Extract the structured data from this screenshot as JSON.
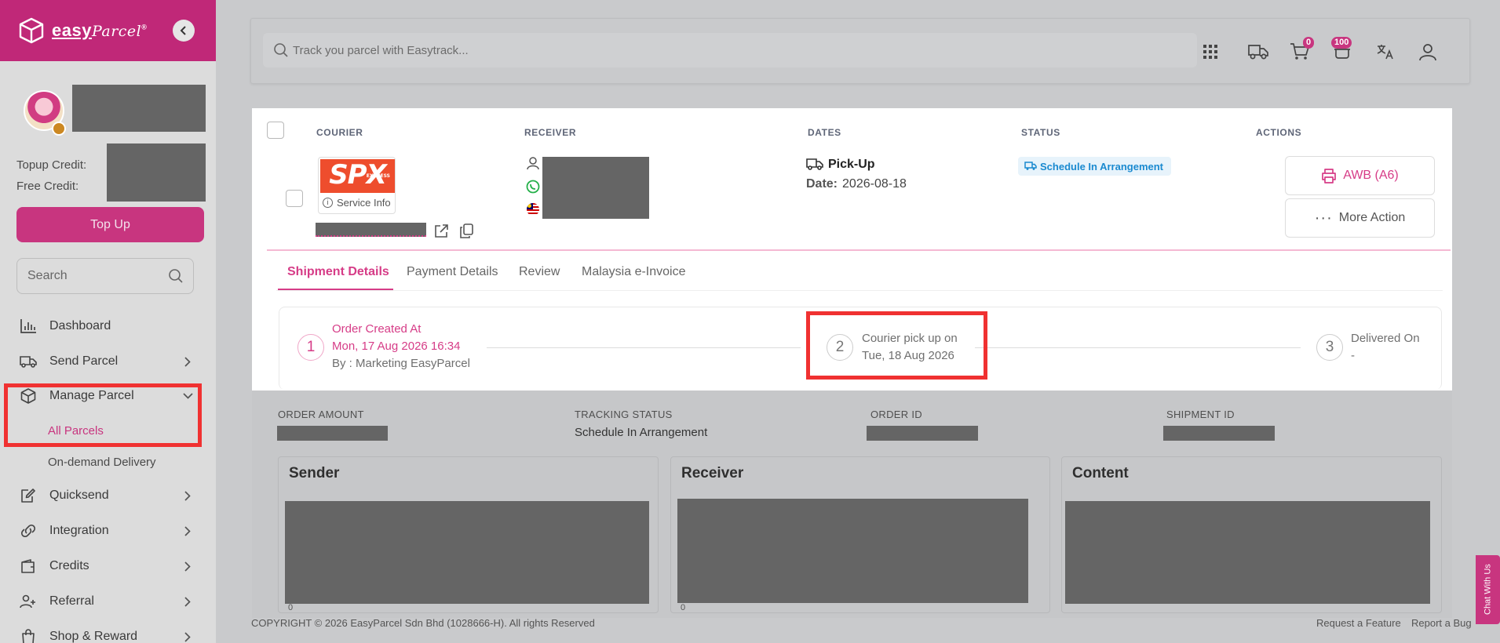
{
  "brand": {
    "name_bold": "easy",
    "name_script": "Parcel",
    "reg": "®"
  },
  "sidebar": {
    "credit_labels": [
      "Topup Credit:",
      "Free Credit:"
    ],
    "topup_label": "Top Up",
    "search_placeholder": "Search",
    "items": [
      {
        "label": "Dashboard",
        "icon": "bar-chart-icon"
      },
      {
        "label": "Send Parcel",
        "icon": "truck-icon"
      },
      {
        "label": "Manage Parcel",
        "icon": "box-icon"
      },
      {
        "label": "Quicksend",
        "icon": "edit-icon"
      },
      {
        "label": "Integration",
        "icon": "link-icon"
      },
      {
        "label": "Credits",
        "icon": "wallet-icon"
      },
      {
        "label": "Referral",
        "icon": "add-user-icon"
      },
      {
        "label": "Shop & Reward",
        "icon": "shopping-bag-icon"
      }
    ],
    "subitems": [
      "All Parcels",
      "On-demand Delivery"
    ]
  },
  "topbar": {
    "track_placeholder": "Track you parcel with Easytrack...",
    "cart_count": "0",
    "notif_count": "100"
  },
  "table": {
    "headers": [
      "COURIER",
      "RECEIVER",
      "DATES",
      "STATUS",
      "ACTIONS"
    ],
    "row": {
      "courier_logo": "SPX",
      "courier_logo_sub": "EXPRESS",
      "service_info": "Service Info",
      "pickup_title": "Pick-Up",
      "date_label": "Date:",
      "date_value": "2026-08-18",
      "status": "Schedule In Arrangement",
      "awb_label": "AWB (A6)",
      "more_label": "More Action"
    }
  },
  "tabs": [
    "Shipment Details",
    "Payment Details",
    "Review",
    "Malaysia e-Invoice"
  ],
  "timeline": {
    "steps": [
      {
        "num": "1",
        "title": "Order Created At",
        "line2": "Mon, 17 Aug 2026 16:34",
        "line3": "By : Marketing EasyParcel"
      },
      {
        "num": "2",
        "title": "Courier pick up on",
        "line2": "Tue, 18 Aug 2026"
      },
      {
        "num": "3",
        "title": "Delivered On",
        "line2": "-"
      }
    ]
  },
  "details": {
    "labels": [
      "ORDER AMOUNT",
      "TRACKING STATUS",
      "ORDER ID",
      "SHIPMENT ID"
    ],
    "tracking_status": "Schedule In Arrangement"
  },
  "cards": [
    "Sender",
    "Receiver",
    "Content"
  ],
  "card_zero": "0",
  "footer": {
    "copyright": "COPYRIGHT © 2026 EasyParcel Sdn Bhd (1028666-H). All rights Reserved",
    "links": [
      "Request a Feature",
      "Report a Bug"
    ]
  },
  "chat_label": "Chat With Us",
  "colors": {
    "brand": "#c02878",
    "accent": "#d63c87",
    "status": "#1a8ad0",
    "highlight": "#f03131"
  }
}
